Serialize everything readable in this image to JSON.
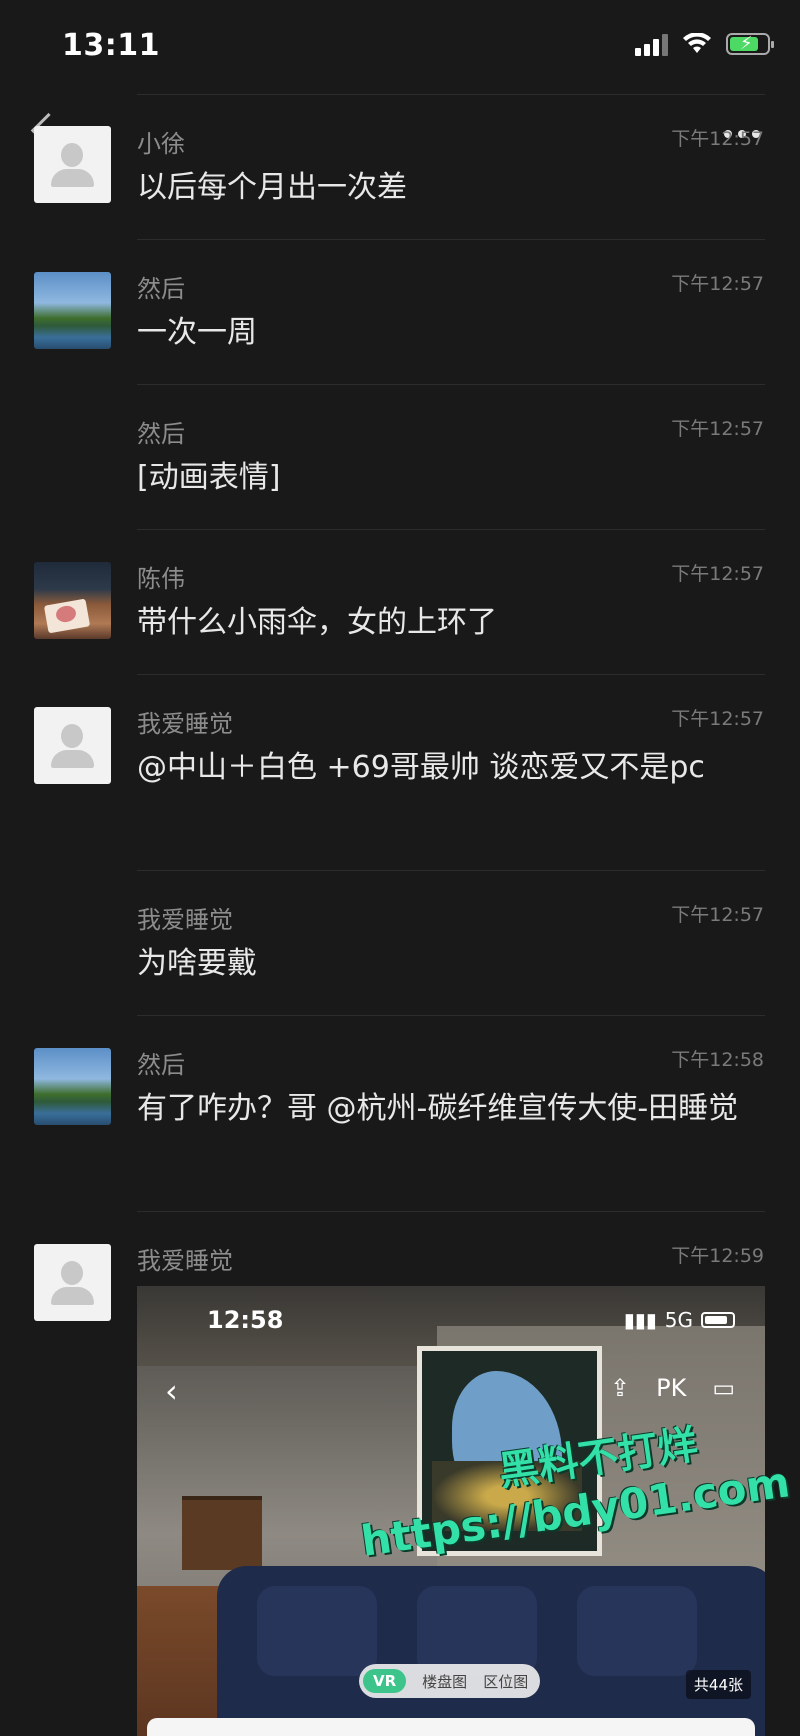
{
  "status_bar": {
    "time": "13:11"
  },
  "messages": [
    {
      "name": "小徐",
      "timestamp": "下午12:57",
      "text": "以后每个月出一次差",
      "avatar": "default"
    },
    {
      "name": "然后",
      "timestamp": "下午12:57",
      "text": "一次一周",
      "avatar": "scenery"
    },
    {
      "name": "然后",
      "timestamp": "下午12:57",
      "text": "[动画表情]",
      "avatar": "none"
    },
    {
      "name": "陈伟",
      "timestamp": "下午12:57",
      "text": "带什么小雨伞，女的上环了",
      "avatar": "photo"
    },
    {
      "name": "我爱睡觉",
      "timestamp": "下午12:57",
      "text": "@中山＋白色 +69哥最帅 谈恋爱又不是pc",
      "avatar": "default"
    },
    {
      "name": "我爱睡觉",
      "timestamp": "下午12:57",
      "text": "为啥要戴",
      "avatar": "none"
    },
    {
      "name": "然后",
      "timestamp": "下午12:58",
      "text": "有了咋办？哥 @杭州-碳纤维宣传大使-田睡觉",
      "avatar": "scenery"
    },
    {
      "name": "我爱睡觉",
      "timestamp": "下午12:59",
      "text": "",
      "avatar": "default"
    }
  ],
  "image_message": {
    "time": "12:58",
    "network": "5G",
    "pk_label": "PK",
    "tabs": [
      "VR",
      "楼盘图",
      "区位图"
    ],
    "count": "共44张"
  },
  "watermark": {
    "line1": "黑料不打烊",
    "line2": "https://bdy01.com"
  }
}
